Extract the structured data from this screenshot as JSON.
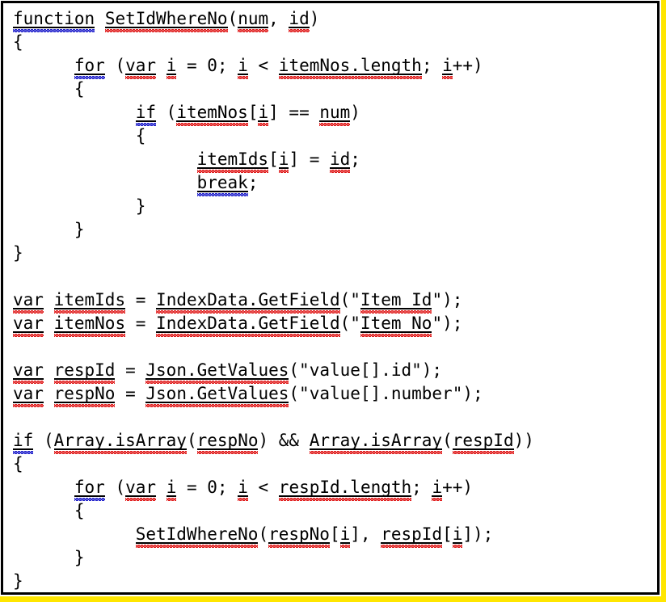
{
  "panel": {
    "border_color": "#000000",
    "background_color": "#ffffff",
    "highlight_color": "#ffe600",
    "text_color": "#000000",
    "spelling_squiggle_color": "#e01b1b",
    "grammar_squiggle_color": "#2222cc",
    "language": "JavaScript"
  },
  "code": {
    "lines": [
      {
        "id": "line-1",
        "text": "function SetIdWhereNo(num, id)",
        "tokens": [
          {
            "t": "function",
            "u": true,
            "sq": "blue"
          },
          {
            "t": " ",
            "u": false,
            "sq": "none"
          },
          {
            "t": "SetIdWhereNo",
            "u": true,
            "sq": "red"
          },
          {
            "t": "(",
            "u": false,
            "sq": "none"
          },
          {
            "t": "num",
            "u": true,
            "sq": "red"
          },
          {
            "t": ", ",
            "u": false,
            "sq": "none"
          },
          {
            "t": "id",
            "u": true,
            "sq": "red"
          },
          {
            "t": ")",
            "u": false,
            "sq": "none"
          }
        ]
      },
      {
        "id": "line-2",
        "text": "{",
        "tokens": [
          {
            "t": "{",
            "u": false,
            "sq": "none"
          }
        ]
      },
      {
        "id": "line-3",
        "text": "      for (var i = 0; i < itemNos.length; i++)",
        "tokens": [
          {
            "t": "      ",
            "u": false,
            "sq": "none"
          },
          {
            "t": "for",
            "u": true,
            "sq": "blue"
          },
          {
            "t": " (",
            "u": false,
            "sq": "none"
          },
          {
            "t": "var",
            "u": true,
            "sq": "red"
          },
          {
            "t": " ",
            "u": false,
            "sq": "none"
          },
          {
            "t": "i",
            "u": true,
            "sq": "red"
          },
          {
            "t": " = 0; ",
            "u": false,
            "sq": "none"
          },
          {
            "t": "i",
            "u": true,
            "sq": "red"
          },
          {
            "t": " < ",
            "u": false,
            "sq": "none"
          },
          {
            "t": "itemNos.length",
            "u": true,
            "sq": "red"
          },
          {
            "t": "; ",
            "u": false,
            "sq": "none"
          },
          {
            "t": "i",
            "u": true,
            "sq": "red"
          },
          {
            "t": "++)",
            "u": false,
            "sq": "none"
          }
        ]
      },
      {
        "id": "line-4",
        "text": "      {",
        "tokens": [
          {
            "t": "      ",
            "u": false,
            "sq": "none"
          },
          {
            "t": "{",
            "u": false,
            "sq": "none"
          }
        ]
      },
      {
        "id": "line-5",
        "text": "            if (itemNos[i] == num)",
        "tokens": [
          {
            "t": "            ",
            "u": false,
            "sq": "none"
          },
          {
            "t": "if",
            "u": true,
            "sq": "blue"
          },
          {
            "t": " (",
            "u": false,
            "sq": "none"
          },
          {
            "t": "itemNos",
            "u": true,
            "sq": "red"
          },
          {
            "t": "[",
            "u": false,
            "sq": "none"
          },
          {
            "t": "i",
            "u": true,
            "sq": "red"
          },
          {
            "t": "] == ",
            "u": false,
            "sq": "none"
          },
          {
            "t": "num",
            "u": true,
            "sq": "red"
          },
          {
            "t": ")",
            "u": false,
            "sq": "none"
          }
        ]
      },
      {
        "id": "line-6",
        "text": "            {",
        "tokens": [
          {
            "t": "            ",
            "u": false,
            "sq": "none"
          },
          {
            "t": "{",
            "u": false,
            "sq": "none"
          }
        ]
      },
      {
        "id": "line-7",
        "text": "                  itemIds[i] = id;",
        "tokens": [
          {
            "t": "                  ",
            "u": false,
            "sq": "none"
          },
          {
            "t": "itemIds",
            "u": true,
            "sq": "red"
          },
          {
            "t": "[",
            "u": false,
            "sq": "none"
          },
          {
            "t": "i",
            "u": true,
            "sq": "red"
          },
          {
            "t": "] = ",
            "u": false,
            "sq": "none"
          },
          {
            "t": "id",
            "u": true,
            "sq": "red"
          },
          {
            "t": ";",
            "u": false,
            "sq": "none"
          }
        ]
      },
      {
        "id": "line-8",
        "text": "                  break;",
        "tokens": [
          {
            "t": "                  ",
            "u": false,
            "sq": "none"
          },
          {
            "t": "break",
            "u": true,
            "sq": "blue"
          },
          {
            "t": ";",
            "u": false,
            "sq": "none"
          }
        ]
      },
      {
        "id": "line-9",
        "text": "            }",
        "tokens": [
          {
            "t": "            ",
            "u": false,
            "sq": "none"
          },
          {
            "t": "}",
            "u": false,
            "sq": "none"
          }
        ]
      },
      {
        "id": "line-10",
        "text": "      }",
        "tokens": [
          {
            "t": "      ",
            "u": false,
            "sq": "none"
          },
          {
            "t": "}",
            "u": false,
            "sq": "none"
          }
        ]
      },
      {
        "id": "line-11",
        "text": "}",
        "tokens": [
          {
            "t": "}",
            "u": false,
            "sq": "none"
          }
        ]
      },
      {
        "id": "line-12",
        "text": "",
        "tokens": []
      },
      {
        "id": "line-13",
        "text": "var itemIds = IndexData.GetField(\"Item_Id\");",
        "tokens": [
          {
            "t": "var",
            "u": true,
            "sq": "red"
          },
          {
            "t": " ",
            "u": false,
            "sq": "none"
          },
          {
            "t": "itemIds",
            "u": true,
            "sq": "red"
          },
          {
            "t": " = ",
            "u": false,
            "sq": "none"
          },
          {
            "t": "IndexData.GetField",
            "u": true,
            "sq": "red"
          },
          {
            "t": "(\"",
            "u": false,
            "sq": "none"
          },
          {
            "t": "Item_Id",
            "u": true,
            "sq": "red"
          },
          {
            "t": "\");",
            "u": false,
            "sq": "none"
          }
        ]
      },
      {
        "id": "line-14",
        "text": "var itemNos = IndexData.GetField(\"Item_No\");",
        "tokens": [
          {
            "t": "var",
            "u": true,
            "sq": "red"
          },
          {
            "t": " ",
            "u": false,
            "sq": "none"
          },
          {
            "t": "itemNos",
            "u": true,
            "sq": "red"
          },
          {
            "t": " = ",
            "u": false,
            "sq": "none"
          },
          {
            "t": "IndexData.GetField",
            "u": true,
            "sq": "red"
          },
          {
            "t": "(\"",
            "u": false,
            "sq": "none"
          },
          {
            "t": "Item_No",
            "u": true,
            "sq": "red"
          },
          {
            "t": "\");",
            "u": false,
            "sq": "none"
          }
        ]
      },
      {
        "id": "line-15",
        "text": "",
        "tokens": []
      },
      {
        "id": "line-16",
        "text": "var respId = Json.GetValues(\"value[].id\");",
        "tokens": [
          {
            "t": "var",
            "u": true,
            "sq": "red"
          },
          {
            "t": " ",
            "u": false,
            "sq": "none"
          },
          {
            "t": "respId",
            "u": true,
            "sq": "red"
          },
          {
            "t": " = ",
            "u": false,
            "sq": "none"
          },
          {
            "t": "Json.GetValues",
            "u": true,
            "sq": "red"
          },
          {
            "t": "(\"value[].id\");",
            "u": false,
            "sq": "none"
          }
        ]
      },
      {
        "id": "line-17",
        "text": "var respNo = Json.GetValues(\"value[].number\");",
        "tokens": [
          {
            "t": "var",
            "u": true,
            "sq": "red"
          },
          {
            "t": " ",
            "u": false,
            "sq": "none"
          },
          {
            "t": "respNo",
            "u": true,
            "sq": "red"
          },
          {
            "t": " = ",
            "u": false,
            "sq": "none"
          },
          {
            "t": "Json.GetValues",
            "u": true,
            "sq": "red"
          },
          {
            "t": "(\"value[].number\");",
            "u": false,
            "sq": "none"
          }
        ]
      },
      {
        "id": "line-18",
        "text": "",
        "tokens": []
      },
      {
        "id": "line-19",
        "text": "if (Array.isArray(respNo) && Array.isArray(respId))",
        "tokens": [
          {
            "t": "if",
            "u": true,
            "sq": "blue"
          },
          {
            "t": " (",
            "u": false,
            "sq": "none"
          },
          {
            "t": "Array.isArray",
            "u": true,
            "sq": "red"
          },
          {
            "t": "(",
            "u": false,
            "sq": "none"
          },
          {
            "t": "respNo",
            "u": true,
            "sq": "red"
          },
          {
            "t": ") && ",
            "u": false,
            "sq": "none"
          },
          {
            "t": "Array.isArray",
            "u": true,
            "sq": "red"
          },
          {
            "t": "(",
            "u": false,
            "sq": "none"
          },
          {
            "t": "respId",
            "u": true,
            "sq": "red"
          },
          {
            "t": "))",
            "u": false,
            "sq": "none"
          }
        ]
      },
      {
        "id": "line-20",
        "text": "{",
        "tokens": [
          {
            "t": "{",
            "u": false,
            "sq": "none"
          }
        ]
      },
      {
        "id": "line-21",
        "text": "      for (var i = 0; i < respId.length; i++)",
        "tokens": [
          {
            "t": "      ",
            "u": false,
            "sq": "none"
          },
          {
            "t": "for",
            "u": true,
            "sq": "blue"
          },
          {
            "t": " (",
            "u": false,
            "sq": "none"
          },
          {
            "t": "var",
            "u": true,
            "sq": "red"
          },
          {
            "t": " ",
            "u": false,
            "sq": "none"
          },
          {
            "t": "i",
            "u": true,
            "sq": "red"
          },
          {
            "t": " = 0; ",
            "u": false,
            "sq": "none"
          },
          {
            "t": "i",
            "u": true,
            "sq": "red"
          },
          {
            "t": " < ",
            "u": false,
            "sq": "none"
          },
          {
            "t": "respId.length",
            "u": true,
            "sq": "red"
          },
          {
            "t": "; ",
            "u": false,
            "sq": "none"
          },
          {
            "t": "i",
            "u": true,
            "sq": "red"
          },
          {
            "t": "++)",
            "u": false,
            "sq": "none"
          }
        ]
      },
      {
        "id": "line-22",
        "text": "      {",
        "tokens": [
          {
            "t": "      ",
            "u": false,
            "sq": "none"
          },
          {
            "t": "{",
            "u": false,
            "sq": "none"
          }
        ]
      },
      {
        "id": "line-23",
        "text": "            SetIdWhereNo(respNo[i], respId[i]);",
        "tokens": [
          {
            "t": "            ",
            "u": false,
            "sq": "none"
          },
          {
            "t": "SetIdWhereNo",
            "u": true,
            "sq": "red"
          },
          {
            "t": "(",
            "u": false,
            "sq": "none"
          },
          {
            "t": "respNo",
            "u": true,
            "sq": "red"
          },
          {
            "t": "[",
            "u": false,
            "sq": "none"
          },
          {
            "t": "i",
            "u": true,
            "sq": "red"
          },
          {
            "t": "], ",
            "u": false,
            "sq": "none"
          },
          {
            "t": "respId",
            "u": true,
            "sq": "red"
          },
          {
            "t": "[",
            "u": false,
            "sq": "none"
          },
          {
            "t": "i",
            "u": true,
            "sq": "red"
          },
          {
            "t": "]);",
            "u": false,
            "sq": "none"
          }
        ]
      },
      {
        "id": "line-24",
        "text": "      }",
        "tokens": [
          {
            "t": "      ",
            "u": false,
            "sq": "none"
          },
          {
            "t": "}",
            "u": false,
            "sq": "none"
          }
        ]
      },
      {
        "id": "line-25",
        "text": "}",
        "tokens": [
          {
            "t": "}",
            "u": false,
            "sq": "none"
          }
        ]
      }
    ]
  }
}
